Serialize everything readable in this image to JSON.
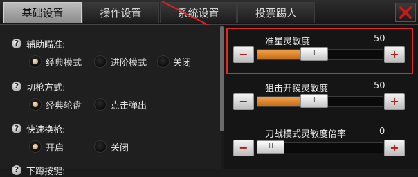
{
  "tabs": [
    {
      "label": "基础设置",
      "active": true
    },
    {
      "label": "操作设置",
      "active": false
    },
    {
      "label": "系统设置",
      "active": false
    },
    {
      "label": "投票踢人",
      "active": false
    }
  ],
  "close_icon": "close-x-icon",
  "settings": [
    {
      "title": "辅助瞄准:",
      "options": [
        {
          "label": "经典模式",
          "selected": true
        },
        {
          "label": "进阶模式",
          "selected": false
        },
        {
          "label": "关闭",
          "selected": false
        }
      ]
    },
    {
      "title": "切枪方式:",
      "options": [
        {
          "label": "经典轮盘",
          "selected": true
        },
        {
          "label": "点击弹出",
          "selected": false
        }
      ]
    },
    {
      "title": "快速换枪:",
      "options": [
        {
          "label": "开启",
          "selected": true
        },
        {
          "label": "关闭",
          "selected": false
        }
      ]
    },
    {
      "title": "下蹲按键:",
      "options": []
    }
  ],
  "sliders": [
    {
      "label": "准星灵敏度",
      "value": "50",
      "level": 0.45,
      "highlighted": true
    },
    {
      "label": "狙击开镜灵敏度",
      "value": "50",
      "level": 0.45,
      "highlighted": false
    },
    {
      "label": "刀战模式灵敏度倍率",
      "value": "0",
      "level": 0.0,
      "highlighted": false
    }
  ],
  "buttons": {
    "minus": "−",
    "plus": "+"
  },
  "colors": {
    "accent": "#e08a2a",
    "highlight": "#d92b2b",
    "close_red": "#c21b1b"
  }
}
